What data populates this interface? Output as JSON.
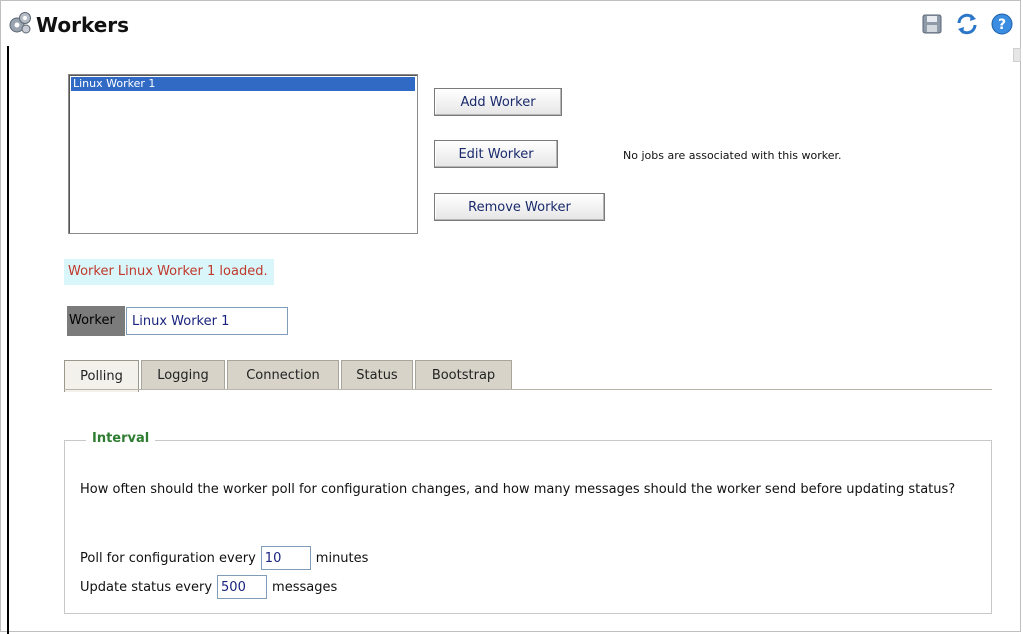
{
  "window": {
    "title": "Workers"
  },
  "toolbar": {
    "save_icon": "save-icon",
    "refresh_icon": "refresh-icon",
    "help_icon": "help-icon"
  },
  "workers_list": {
    "items": [
      "Linux Worker 1"
    ],
    "selected": "Linux Worker 1"
  },
  "buttons": {
    "add": "Add Worker",
    "edit": "Edit Worker",
    "remove": "Remove Worker"
  },
  "jobs_message": "No jobs are associated with this worker.",
  "status_message": "Worker Linux Worker 1 loaded.",
  "worker_field": {
    "label": "Worker",
    "value": "Linux Worker 1"
  },
  "tabs": [
    {
      "label": "Polling",
      "active": true
    },
    {
      "label": "Logging",
      "active": false
    },
    {
      "label": "Connection",
      "active": false
    },
    {
      "label": "Status",
      "active": false
    },
    {
      "label": "Bootstrap",
      "active": false
    }
  ],
  "interval": {
    "legend": "Interval",
    "description": "How often should the worker poll for configuration changes, and how many messages should the worker send before updating status?",
    "poll_prefix": "Poll for configuration every",
    "poll_value": "10",
    "poll_suffix": "minutes",
    "update_prefix": "Update status every",
    "update_value": "500",
    "update_suffix": "messages"
  },
  "colors": {
    "selection": "#316ac5",
    "status_text": "#c0392b",
    "status_bg": "#d9f6fb",
    "legend": "#2e7d32"
  }
}
